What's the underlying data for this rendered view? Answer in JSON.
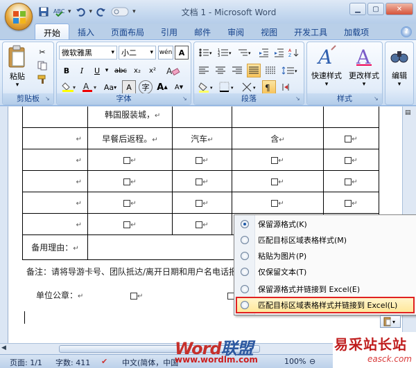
{
  "window": {
    "title": "文档 1 - Microsoft Word"
  },
  "ribbon_tabs": [
    "开始",
    "插入",
    "页面布局",
    "引用",
    "邮件",
    "审阅",
    "视图",
    "开发工具",
    "加载项"
  ],
  "clipboard": {
    "paste_label": "粘贴",
    "group_label": "剪贴板"
  },
  "font": {
    "name": "微软雅黑",
    "size": "小二",
    "group_label": "字体",
    "phonetic": "wén",
    "charborder": "A",
    "bold": "B",
    "italic": "I",
    "underline": "U",
    "strike": "abc",
    "subscript": "x₂",
    "superscript": "x²",
    "aa": "Aa",
    "grow": "A",
    "shrink": "A",
    "enclosed": "字"
  },
  "paragraph": {
    "group_label": "段落"
  },
  "styles": {
    "quick_label": "快速样式",
    "change_label": "更改样式",
    "group_label": "样式"
  },
  "editing": {
    "label": "编辑"
  },
  "table": {
    "row0": {
      "c1": "韩国服装城，"
    },
    "row1": {
      "c1": "早餐后返程。",
      "c2": "汽车",
      "c3": "含"
    },
    "reason_label": "备用理由："
  },
  "note": "备注：请将导游卡号、团队抵达/离开日期和用户名电话报出",
  "seal_label": "单位公章：",
  "paste_options": [
    {
      "label": "保留源格式(K)",
      "selected": true
    },
    {
      "label": "匹配目标区域表格样式(M)",
      "selected": false
    },
    {
      "label": "粘贴为图片(P)",
      "selected": false
    },
    {
      "label": "仅保留文本(T)",
      "selected": false
    },
    {
      "label": "保留源格式并链接到 Excel(E)",
      "selected": false
    },
    {
      "label": "匹配目标区域表格样式并链接到 Excel(L)",
      "selected": false,
      "highlighted": true
    }
  ],
  "status": {
    "page": "页面: 1/1",
    "words": "字数: 411",
    "language": "中文(简体，中国",
    "zoom": "100%"
  },
  "watermark": {
    "word1": "Word",
    "word2": "联盟",
    "url": "www.wordlm.com"
  },
  "brand": {
    "name": "易采站长站",
    "url": "easck.com"
  }
}
